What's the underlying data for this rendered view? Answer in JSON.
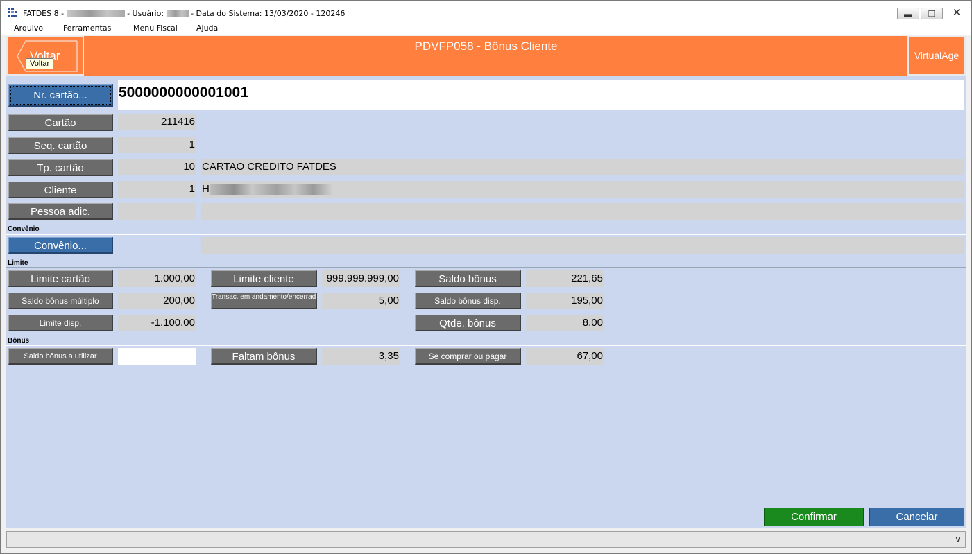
{
  "window": {
    "app_name": "FATDES 8 -",
    "user_label": "- Usuário:",
    "date_label": "- Data do Sistema: 13/03/2020 - 120246",
    "icon": "app-grid-icon",
    "minimize_icon": "minimize-icon",
    "restore_icon": "restore-icon",
    "close_icon": "close-icon"
  },
  "menu": {
    "items": [
      "Arquivo",
      "Ferramentas",
      "Menu Fiscal",
      "Ajuda"
    ]
  },
  "header": {
    "back_label": "Voltar",
    "back_tooltip": "Voltar",
    "title": "PDVFP058 - Bônus Cliente",
    "brand_label": "VirtualAge",
    "color": "#ff7f3f"
  },
  "form": {
    "nr_cartao_label": "Nr. cartão...",
    "nr_cartao_value": "5000000000001001",
    "cartao_label": "Cartão",
    "cartao_value": "211416",
    "seq_cartao_label": "Seq. cartão",
    "seq_cartao_value": "1",
    "tp_cartao_label": "Tp. cartão",
    "tp_cartao_code": "10",
    "tp_cartao_desc": "CARTAO CREDITO FATDES",
    "cliente_label": "Cliente",
    "cliente_code": "1",
    "cliente_name_prefix": "H",
    "pessoa_adic_label": "Pessoa adic.",
    "pessoa_adic_code": "",
    "pessoa_adic_name": ""
  },
  "convenio": {
    "section": "Convênio",
    "button_label": "Convênio...",
    "value": ""
  },
  "limite": {
    "section": "Limite",
    "limite_cartao_label": "Limite cartão",
    "limite_cartao_value": "1.000,00",
    "limite_cliente_label": "Limite cliente",
    "limite_cliente_value": "999.999.999,00",
    "saldo_bonus_label": "Saldo bônus",
    "saldo_bonus_value": "221,65",
    "saldo_bonus_multiplo_label": "Saldo bônus múltiplo",
    "saldo_bonus_multiplo_value": "200,00",
    "transac_label": "Transac. em andamento/encerrada",
    "transac_value": "5,00",
    "saldo_bonus_disp_label": "Saldo bônus disp.",
    "saldo_bonus_disp_value": "195,00",
    "limite_disp_label": "Limite disp.",
    "limite_disp_value": "-1.100,00",
    "qtde_bonus_label": "Qtde. bônus",
    "qtde_bonus_value": "8,00"
  },
  "bonus": {
    "section": "Bônus",
    "saldo_utilizar_label": "Saldo bônus a utilizar",
    "saldo_utilizar_value": "",
    "faltam_label": "Faltam bônus",
    "faltam_value": "3,35",
    "se_comprar_label": "Se comprar ou pagar",
    "se_comprar_value": "67,00"
  },
  "actions": {
    "confirm_label": "Confirmar",
    "cancel_label": "Cancelar",
    "confirm_color": "#1a8a1f",
    "cancel_color": "#3a6ea8"
  },
  "statusbar": {
    "dropdown_icon": "chevron-down-icon"
  }
}
